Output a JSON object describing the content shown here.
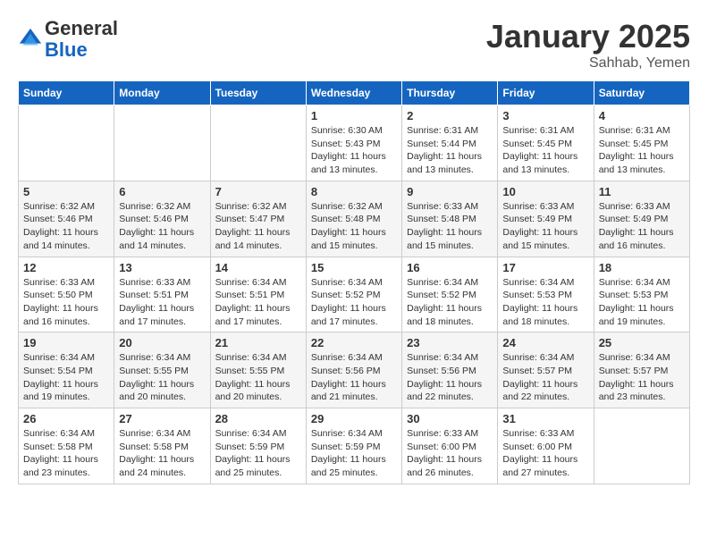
{
  "header": {
    "logo_line1": "General",
    "logo_line2": "Blue",
    "month": "January 2025",
    "location": "Sahhab, Yemen"
  },
  "weekdays": [
    "Sunday",
    "Monday",
    "Tuesday",
    "Wednesday",
    "Thursday",
    "Friday",
    "Saturday"
  ],
  "weeks": [
    [
      {
        "day": "",
        "info": ""
      },
      {
        "day": "",
        "info": ""
      },
      {
        "day": "",
        "info": ""
      },
      {
        "day": "1",
        "info": "Sunrise: 6:30 AM\nSunset: 5:43 PM\nDaylight: 11 hours\nand 13 minutes."
      },
      {
        "day": "2",
        "info": "Sunrise: 6:31 AM\nSunset: 5:44 PM\nDaylight: 11 hours\nand 13 minutes."
      },
      {
        "day": "3",
        "info": "Sunrise: 6:31 AM\nSunset: 5:45 PM\nDaylight: 11 hours\nand 13 minutes."
      },
      {
        "day": "4",
        "info": "Sunrise: 6:31 AM\nSunset: 5:45 PM\nDaylight: 11 hours\nand 13 minutes."
      }
    ],
    [
      {
        "day": "5",
        "info": "Sunrise: 6:32 AM\nSunset: 5:46 PM\nDaylight: 11 hours\nand 14 minutes."
      },
      {
        "day": "6",
        "info": "Sunrise: 6:32 AM\nSunset: 5:46 PM\nDaylight: 11 hours\nand 14 minutes."
      },
      {
        "day": "7",
        "info": "Sunrise: 6:32 AM\nSunset: 5:47 PM\nDaylight: 11 hours\nand 14 minutes."
      },
      {
        "day": "8",
        "info": "Sunrise: 6:32 AM\nSunset: 5:48 PM\nDaylight: 11 hours\nand 15 minutes."
      },
      {
        "day": "9",
        "info": "Sunrise: 6:33 AM\nSunset: 5:48 PM\nDaylight: 11 hours\nand 15 minutes."
      },
      {
        "day": "10",
        "info": "Sunrise: 6:33 AM\nSunset: 5:49 PM\nDaylight: 11 hours\nand 15 minutes."
      },
      {
        "day": "11",
        "info": "Sunrise: 6:33 AM\nSunset: 5:49 PM\nDaylight: 11 hours\nand 16 minutes."
      }
    ],
    [
      {
        "day": "12",
        "info": "Sunrise: 6:33 AM\nSunset: 5:50 PM\nDaylight: 11 hours\nand 16 minutes."
      },
      {
        "day": "13",
        "info": "Sunrise: 6:33 AM\nSunset: 5:51 PM\nDaylight: 11 hours\nand 17 minutes."
      },
      {
        "day": "14",
        "info": "Sunrise: 6:34 AM\nSunset: 5:51 PM\nDaylight: 11 hours\nand 17 minutes."
      },
      {
        "day": "15",
        "info": "Sunrise: 6:34 AM\nSunset: 5:52 PM\nDaylight: 11 hours\nand 17 minutes."
      },
      {
        "day": "16",
        "info": "Sunrise: 6:34 AM\nSunset: 5:52 PM\nDaylight: 11 hours\nand 18 minutes."
      },
      {
        "day": "17",
        "info": "Sunrise: 6:34 AM\nSunset: 5:53 PM\nDaylight: 11 hours\nand 18 minutes."
      },
      {
        "day": "18",
        "info": "Sunrise: 6:34 AM\nSunset: 5:53 PM\nDaylight: 11 hours\nand 19 minutes."
      }
    ],
    [
      {
        "day": "19",
        "info": "Sunrise: 6:34 AM\nSunset: 5:54 PM\nDaylight: 11 hours\nand 19 minutes."
      },
      {
        "day": "20",
        "info": "Sunrise: 6:34 AM\nSunset: 5:55 PM\nDaylight: 11 hours\nand 20 minutes."
      },
      {
        "day": "21",
        "info": "Sunrise: 6:34 AM\nSunset: 5:55 PM\nDaylight: 11 hours\nand 20 minutes."
      },
      {
        "day": "22",
        "info": "Sunrise: 6:34 AM\nSunset: 5:56 PM\nDaylight: 11 hours\nand 21 minutes."
      },
      {
        "day": "23",
        "info": "Sunrise: 6:34 AM\nSunset: 5:56 PM\nDaylight: 11 hours\nand 22 minutes."
      },
      {
        "day": "24",
        "info": "Sunrise: 6:34 AM\nSunset: 5:57 PM\nDaylight: 11 hours\nand 22 minutes."
      },
      {
        "day": "25",
        "info": "Sunrise: 6:34 AM\nSunset: 5:57 PM\nDaylight: 11 hours\nand 23 minutes."
      }
    ],
    [
      {
        "day": "26",
        "info": "Sunrise: 6:34 AM\nSunset: 5:58 PM\nDaylight: 11 hours\nand 23 minutes."
      },
      {
        "day": "27",
        "info": "Sunrise: 6:34 AM\nSunset: 5:58 PM\nDaylight: 11 hours\nand 24 minutes."
      },
      {
        "day": "28",
        "info": "Sunrise: 6:34 AM\nSunset: 5:59 PM\nDaylight: 11 hours\nand 25 minutes."
      },
      {
        "day": "29",
        "info": "Sunrise: 6:34 AM\nSunset: 5:59 PM\nDaylight: 11 hours\nand 25 minutes."
      },
      {
        "day": "30",
        "info": "Sunrise: 6:33 AM\nSunset: 6:00 PM\nDaylight: 11 hours\nand 26 minutes."
      },
      {
        "day": "31",
        "info": "Sunrise: 6:33 AM\nSunset: 6:00 PM\nDaylight: 11 hours\nand 27 minutes."
      },
      {
        "day": "",
        "info": ""
      }
    ]
  ]
}
